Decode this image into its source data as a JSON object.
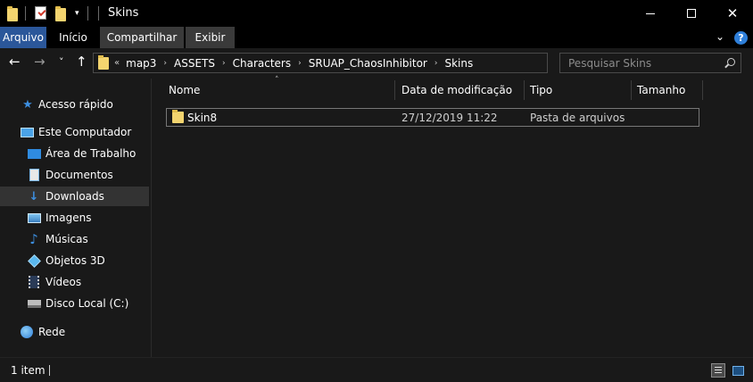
{
  "window": {
    "title": "Skins",
    "minimize_glyph": "",
    "close_glyph": "✕"
  },
  "ribbon": {
    "tabs": [
      {
        "label": "Arquivo"
      },
      {
        "label": "Início"
      },
      {
        "label": "Compartilhar"
      },
      {
        "label": "Exibir"
      }
    ],
    "expand_glyph": "⌄",
    "help_glyph": "?"
  },
  "nav": {
    "back_glyph": "←",
    "forward_glyph": "→",
    "recent_glyph": "˅",
    "up_glyph": "↑"
  },
  "address": {
    "lead": "«",
    "separator": "›",
    "crumbs": [
      "map3",
      "ASSETS",
      "Characters",
      "SRUAP_ChaosInhibitor",
      "Skins"
    ]
  },
  "search": {
    "placeholder": "Pesquisar Skins"
  },
  "sidebar": {
    "items": [
      {
        "label": "Acesso rápido",
        "icon": "star-icon"
      },
      {
        "label": "Este Computador",
        "icon": "computer-icon"
      },
      {
        "label": "Área de Trabalho",
        "icon": "desktop-icon"
      },
      {
        "label": "Documentos",
        "icon": "documents-icon"
      },
      {
        "label": "Downloads",
        "icon": "download-icon",
        "selected": true
      },
      {
        "label": "Imagens",
        "icon": "pictures-icon"
      },
      {
        "label": "Músicas",
        "icon": "music-icon"
      },
      {
        "label": "Objetos 3D",
        "icon": "objects-3d-icon"
      },
      {
        "label": "Vídeos",
        "icon": "videos-icon"
      },
      {
        "label": "Disco Local (C:)",
        "icon": "drive-icon"
      },
      {
        "label": "Rede",
        "icon": "network-icon"
      }
    ]
  },
  "columns": {
    "name": "Nome",
    "modified": "Data de modificação",
    "type": "Tipo",
    "size": "Tamanho",
    "sort_glyph": "˄"
  },
  "files": [
    {
      "name": "Skin8",
      "modified": "27/12/2019 11:22",
      "type": "Pasta de arquivos",
      "size": "",
      "icon": "folder-icon"
    }
  ],
  "status": {
    "item_count": "1 item"
  },
  "colors": {
    "file_tab": "#2b579a",
    "folder": "#f3d46f",
    "selection": "#333333",
    "accent_blue": "#2f7fd9"
  }
}
